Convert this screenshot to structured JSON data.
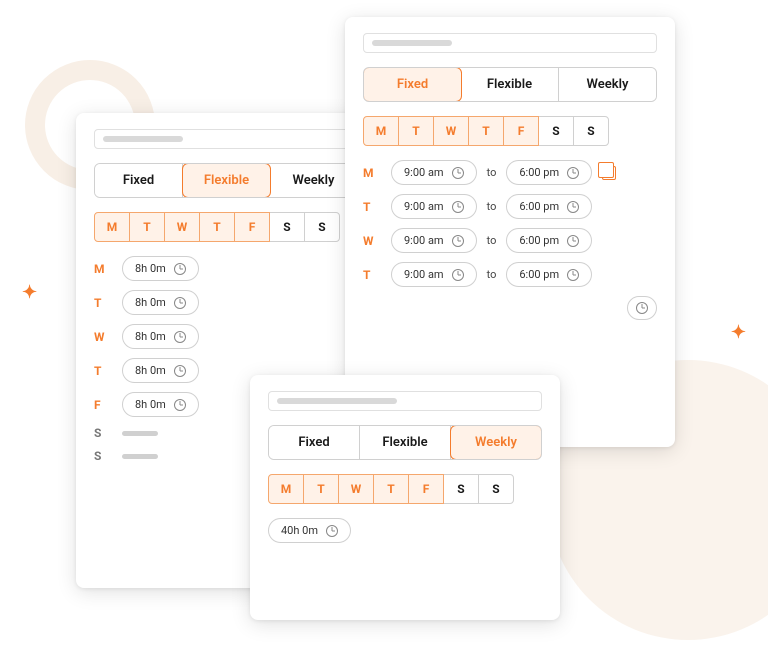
{
  "colors": {
    "accent": "#f47c2d",
    "accent_bg": "#fff2e8"
  },
  "tabs": {
    "fixed": "Fixed",
    "flexible": "Flexible",
    "weekly": "Weekly"
  },
  "days": [
    {
      "abbr": "M",
      "working": true
    },
    {
      "abbr": "T",
      "working": true
    },
    {
      "abbr": "W",
      "working": true
    },
    {
      "abbr": "T",
      "working": true
    },
    {
      "abbr": "F",
      "working": true
    },
    {
      "abbr": "S",
      "working": false
    },
    {
      "abbr": "S",
      "working": false
    }
  ],
  "flexible": {
    "rows": [
      {
        "day": "M",
        "duration": "8h 0m"
      },
      {
        "day": "T",
        "duration": "8h 0m"
      },
      {
        "day": "W",
        "duration": "8h 0m"
      },
      {
        "day": "T",
        "duration": "8h 0m"
      },
      {
        "day": "F",
        "duration": "8h 0m"
      }
    ]
  },
  "fixed": {
    "to": "to",
    "rows": [
      {
        "day": "M",
        "start": "9:00 am",
        "end": "6:00 pm"
      },
      {
        "day": "T",
        "start": "9:00 am",
        "end": "6:00 pm"
      },
      {
        "day": "W",
        "start": "9:00 am",
        "end": "6:00 pm"
      },
      {
        "day": "T",
        "start": "9:00 am",
        "end": "6:00 pm"
      }
    ]
  },
  "weekly": {
    "total": "40h 0m"
  }
}
